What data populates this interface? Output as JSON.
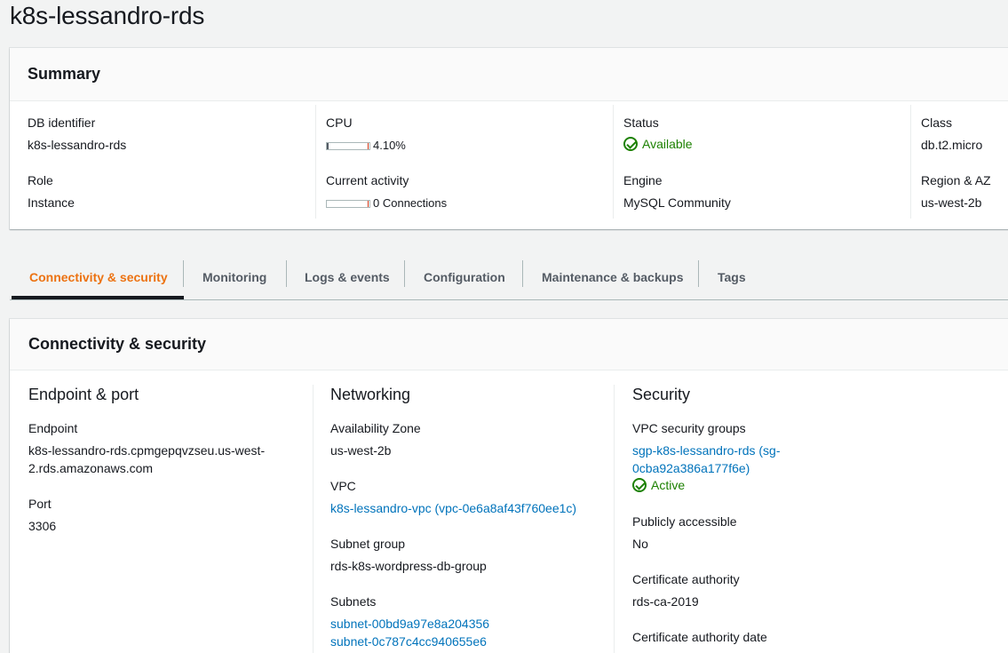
{
  "page": {
    "title": "k8s-lessandro-rds"
  },
  "summary": {
    "header": "Summary",
    "db_identifier": {
      "label": "DB identifier",
      "value": "k8s-lessandro-rds"
    },
    "role": {
      "label": "Role",
      "value": "Instance"
    },
    "cpu": {
      "label": "CPU",
      "value": "4.10%",
      "fraction": 0.041
    },
    "current_activity": {
      "label": "Current activity",
      "value": "0 Connections",
      "fraction": 0
    },
    "status": {
      "label": "Status",
      "value": "Available"
    },
    "engine": {
      "label": "Engine",
      "value": "MySQL Community"
    },
    "class": {
      "label": "Class",
      "value": "db.t2.micro"
    },
    "region_az": {
      "label": "Region & AZ",
      "value": "us-west-2b"
    }
  },
  "tabs": [
    {
      "label": "Connectivity & security",
      "active": true
    },
    {
      "label": "Monitoring"
    },
    {
      "label": "Logs & events"
    },
    {
      "label": "Configuration"
    },
    {
      "label": "Maintenance & backups"
    },
    {
      "label": "Tags"
    }
  ],
  "connectivity": {
    "header": "Connectivity & security",
    "endpoint_port": {
      "title": "Endpoint & port",
      "endpoint_label": "Endpoint",
      "endpoint_line1": "k8s-lessandro-rds.cpmgepqvzseu.us-west-",
      "endpoint_line2": "2.rds.amazonaws.com",
      "port_label": "Port",
      "port_value": "3306"
    },
    "networking": {
      "title": "Networking",
      "az_label": "Availability Zone",
      "az_value": "us-west-2b",
      "vpc_label": "VPC",
      "vpc_value": "k8s-lessandro-vpc (vpc-0e6a8af43f760ee1c)",
      "subnet_group_label": "Subnet group",
      "subnet_group_value": "rds-k8s-wordpress-db-group",
      "subnets_label": "Subnets",
      "subnets": [
        "subnet-00bd9a97e8a204356",
        "subnet-0c787c4cc940655e6"
      ]
    },
    "security": {
      "title": "Security",
      "vpc_sg_label": "VPC security groups",
      "vpc_sg_line1": "sgp-k8s-lessandro-rds (sg-",
      "vpc_sg_line2": "0cba92a386a177f6e)",
      "sg_status": "Active",
      "public_label": "Publicly accessible",
      "public_value": "No",
      "ca_label": "Certificate authority",
      "ca_value": "rds-ca-2019",
      "ca_date_label": "Certificate authority date"
    }
  },
  "colors": {
    "accent": "#ec7211",
    "link": "#0073bb",
    "success": "#1d8102"
  }
}
